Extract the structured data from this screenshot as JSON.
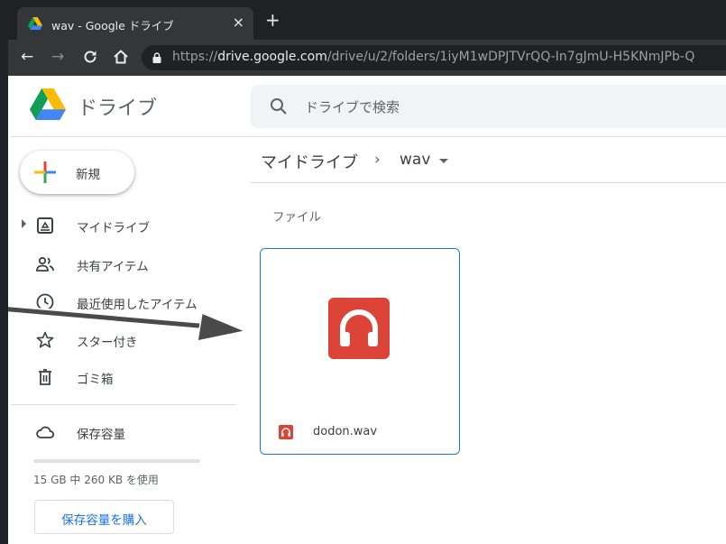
{
  "browser": {
    "tab_title": "wav - Google ドライブ",
    "tab_close": "×",
    "new_tab": "+",
    "url_prefix": "https://",
    "url_host": "drive.google.com",
    "url_path": "/drive/u/2/folders/1iyM1wDPJTVrQQ-In7gJmU-H5KNmJPb-Q"
  },
  "header": {
    "app_name": "ドライブ",
    "search_placeholder": "ドライブで検索"
  },
  "sidebar": {
    "new_label": "新規",
    "items": [
      {
        "label": "マイドライブ",
        "icon": "my-drive-icon"
      },
      {
        "label": "共有アイテム",
        "icon": "shared-people-icon"
      },
      {
        "label": "最近使用したアイテム",
        "icon": "clock-icon"
      },
      {
        "label": "スター付き",
        "icon": "star-icon"
      },
      {
        "label": "ゴミ箱",
        "icon": "trash-icon"
      }
    ],
    "storage_label": "保存容量",
    "storage_used_text": "15 GB 中 260 KB を使用",
    "storage_used_fraction": 0.0,
    "buy_storage_label": "保存容量を購入"
  },
  "main": {
    "breadcrumb_root": "マイドライブ",
    "breadcrumb_separator": "›",
    "breadcrumb_current": "wav",
    "section_label": "ファイル",
    "files": [
      {
        "name": "dodon.wav",
        "type": "audio",
        "icon": "headphones-audio-icon"
      }
    ]
  },
  "colors": {
    "accent": "#1a73e8",
    "audio_red": "#db4437",
    "chrome_dark": "#202124",
    "chrome_toolbar": "#35363a"
  }
}
